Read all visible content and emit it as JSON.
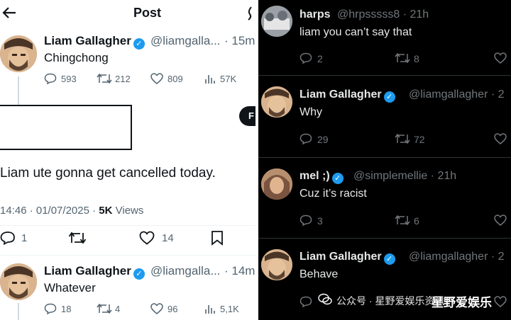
{
  "left": {
    "header": {
      "title": "Post"
    },
    "tweet1": {
      "name": "Liam Gallagher",
      "handle": "@liamgalla...",
      "time": "· 15m",
      "text": "Chingchong",
      "replies": "593",
      "retweets": "212",
      "likes": "809",
      "views": "57K"
    },
    "main": {
      "text": "Liam ute gonna get cancelled today.",
      "datetime": "14:46 · 01/07/2025 · ",
      "views_count": "5K",
      "views_label": " Views",
      "replies": "1",
      "likes": "14"
    },
    "tweet2": {
      "name": "Liam Gallagher",
      "handle": "@liamgalla...",
      "time": "· 14m",
      "text": "Whatever",
      "replies": "18",
      "retweets": "4",
      "likes": "96",
      "views": "5,1K"
    }
  },
  "right": {
    "tweet1": {
      "name": "harps",
      "handle": "@hrpsssss8 · 21h",
      "text": "liam you can’t say that",
      "replies": "2",
      "retweets": "8"
    },
    "tweet2": {
      "name": "Liam Gallagher",
      "handle": "@liamgallagher · 2",
      "text": "Why",
      "replies": "29",
      "retweets": "72"
    },
    "tweet3": {
      "name": "mel ;)",
      "handle": "@simplemellie · 21h",
      "text": "Cuz it’s racist",
      "replies": "3",
      "retweets": "6"
    },
    "tweet4": {
      "name": "Liam Gallagher",
      "handle": "@liamgallagher · 2",
      "text": "Behave"
    }
  },
  "watermark": {
    "left": "公众号 · 星野爱娱乐资讯",
    "right": "星野爱娱乐"
  },
  "colors": {
    "accent": "#1d9bf0",
    "dark_bg": "#000000",
    "light_bg": "#ffffff"
  }
}
